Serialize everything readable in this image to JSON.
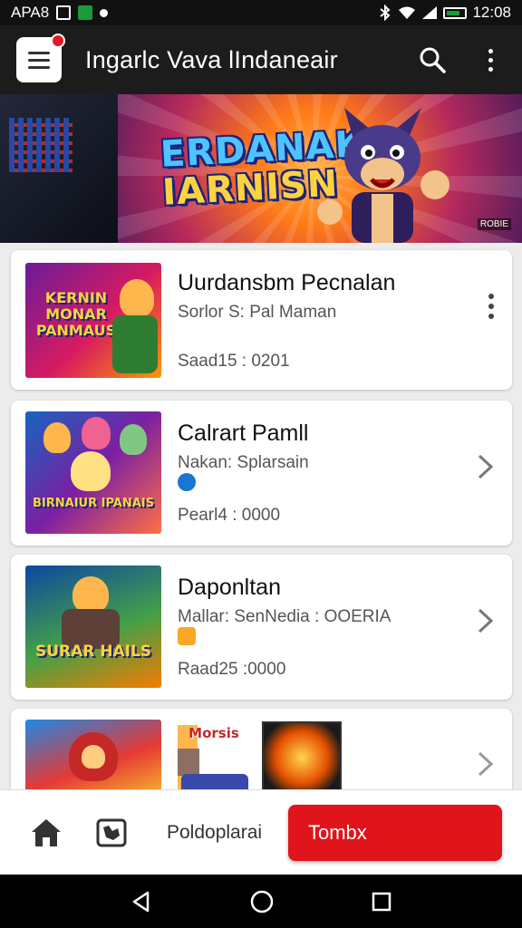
{
  "status_bar": {
    "left_text": "APA8",
    "time": "12:08"
  },
  "app_bar": {
    "title": "Ingarlc Vava lIndaneair",
    "search_icon": "search-icon",
    "menu_icon": "more-vert-icon"
  },
  "banner": {
    "title_line1": "ERDANAK",
    "title_line2": "IARNISN",
    "tag": "ROBIE"
  },
  "games": [
    {
      "title": "Uurdansbm Pecnalan",
      "subtitle": "Sorlor S: Pal Maman",
      "meta": "Saad15 : 0201",
      "thumb_text": "KERNIN MONAR PANMAUS",
      "action": "kebab"
    },
    {
      "title": "Calrart Pamll",
      "subtitle": "Nakan: Splarsain",
      "meta": "Pearl4 : 0000",
      "thumb_text": "BIRNAIUR IPANAIS",
      "action": "chevron"
    },
    {
      "title": "Daponltan",
      "subtitle": "Mallar: SenNedia : OOERIA",
      "meta": "Raad25 :0000",
      "thumb_text": "SURAR HAILS",
      "action": "chevron"
    },
    {
      "title": "",
      "subtitle": "",
      "meta": "",
      "thumb_text": "",
      "extra_thumb_text": "Morsis",
      "action": "chevron"
    }
  ],
  "bottom_bar": {
    "nav_label": "Poldoplarai",
    "cta_label": "Tombx"
  },
  "colors": {
    "accent": "#e0141b",
    "app_bar": "#1c1c1c"
  }
}
